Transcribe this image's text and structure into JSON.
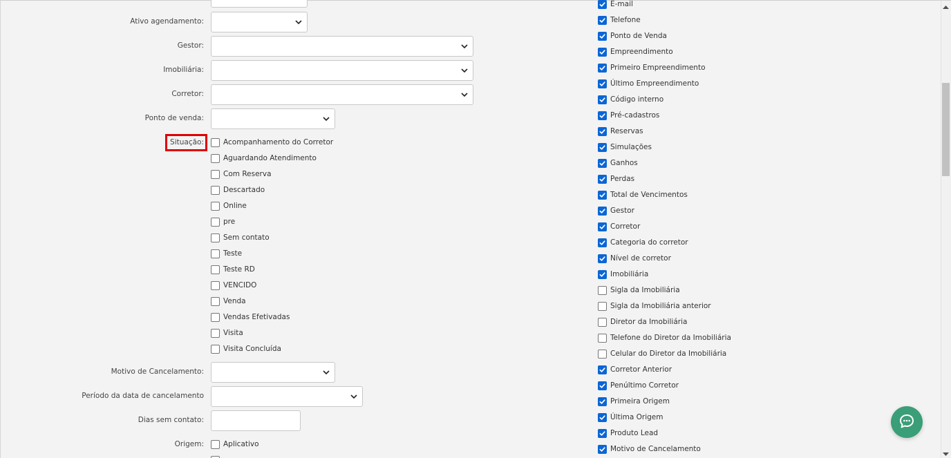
{
  "form": {
    "ativo_agendamento_label": "Ativo agendamento:",
    "gestor_label": "Gestor:",
    "imobiliaria_label": "Imobiliária:",
    "corretor_label": "Corretor:",
    "ponto_venda_label": "Ponto de venda:",
    "situacao_label": "Situação:",
    "motivo_cancelamento_label": "Motivo de Cancelamento:",
    "periodo_cancelamento_label": "Período da data de cancelamento",
    "dias_sem_contato_label": "Dias sem contato:",
    "origem_label": "Origem:",
    "situacao_options": [
      "Acompanhamento do Corretor",
      "Aguardando Atendimento",
      "Com Reserva",
      "Descartado",
      "Online",
      "pre",
      "Sem contato",
      "Teste",
      "Teste RD",
      "VENCIDO",
      "Venda",
      "Vendas Efetivadas",
      "Visita",
      "Visita Concluída"
    ],
    "origem_options": [
      "Aplicativo"
    ]
  },
  "columns": {
    "items": [
      {
        "label": "E-mail",
        "checked": true
      },
      {
        "label": "Telefone",
        "checked": true
      },
      {
        "label": "Ponto de Venda",
        "checked": true
      },
      {
        "label": "Empreendimento",
        "checked": true
      },
      {
        "label": "Primeiro Empreendimento",
        "checked": true
      },
      {
        "label": "Último Empreendimento",
        "checked": true
      },
      {
        "label": "Código interno",
        "checked": true
      },
      {
        "label": "Pré-cadastros",
        "checked": true
      },
      {
        "label": "Reservas",
        "checked": true
      },
      {
        "label": "Simulações",
        "checked": true
      },
      {
        "label": "Ganhos",
        "checked": true
      },
      {
        "label": "Perdas",
        "checked": true
      },
      {
        "label": "Total de Vencimentos",
        "checked": true
      },
      {
        "label": "Gestor",
        "checked": true
      },
      {
        "label": "Corretor",
        "checked": true
      },
      {
        "label": "Categoria do corretor",
        "checked": true
      },
      {
        "label": "Nível de corretor",
        "checked": true
      },
      {
        "label": "Imobiliária",
        "checked": true
      },
      {
        "label": "Sigla da Imobiliária",
        "checked": false
      },
      {
        "label": "Sigla da Imobiliária anterior",
        "checked": false
      },
      {
        "label": "Diretor da Imobiliária",
        "checked": false
      },
      {
        "label": "Telefone do Diretor da Imobiliária",
        "checked": false
      },
      {
        "label": "Celular do Diretor da Imobiliária",
        "checked": false
      },
      {
        "label": "Corretor Anterior",
        "checked": true
      },
      {
        "label": "Penúltimo Corretor",
        "checked": true
      },
      {
        "label": "Primeira Origem",
        "checked": true
      },
      {
        "label": "Última Origem",
        "checked": true
      },
      {
        "label": "Produto Lead",
        "checked": true
      },
      {
        "label": "Motivo de Cancelamento",
        "checked": true
      }
    ]
  },
  "icons": {
    "chat": "chat-bubble-icon",
    "dropdown": "chevron-down-icon",
    "check": "check-icon"
  },
  "colors": {
    "checkbox_on": "#0b66d6",
    "highlight": "#e00000",
    "chat_button": "#3a9e79"
  }
}
